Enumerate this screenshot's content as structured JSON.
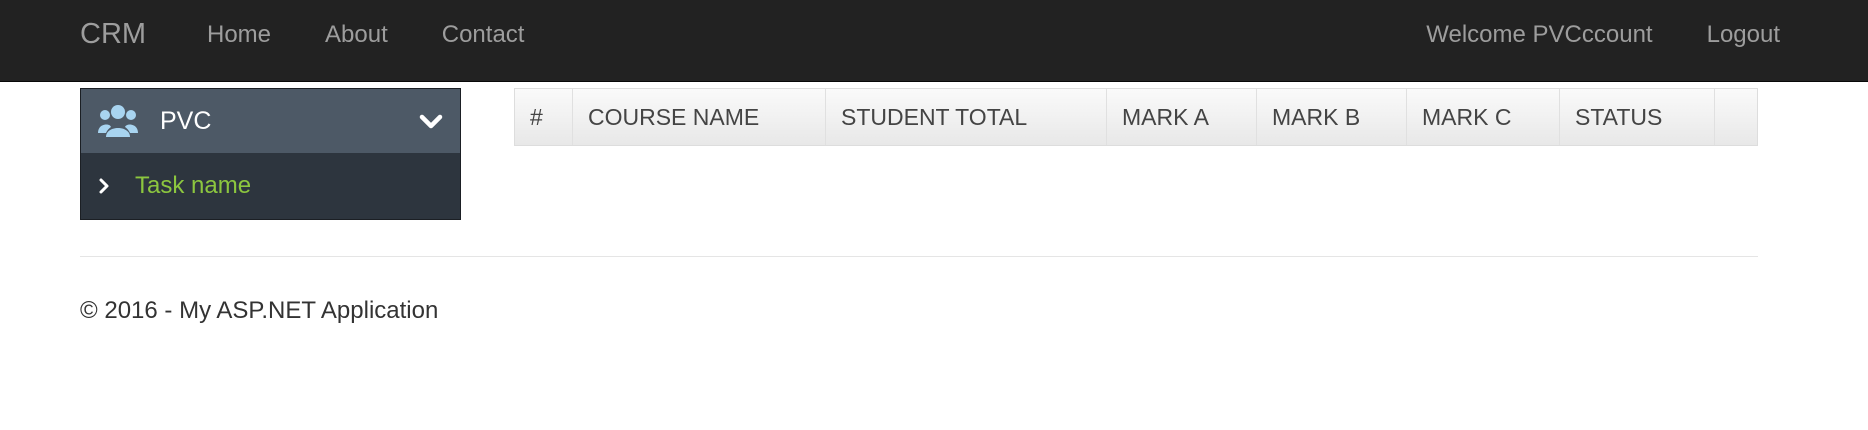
{
  "navbar": {
    "brand": "CRM",
    "links": [
      "Home",
      "About",
      "Contact"
    ],
    "welcome": "Welcome PVCccount",
    "logout": "Logout"
  },
  "sidebar": {
    "title": "PVC",
    "icon": "users-icon",
    "items": [
      {
        "label": "Task name",
        "icon": "chevron-right-icon"
      }
    ]
  },
  "grid": {
    "columns": [
      "#",
      "COURSE NAME",
      "STUDENT TOTAL",
      "MARK A",
      "MARK B",
      "MARK C",
      "STATUS",
      ""
    ],
    "rows": []
  },
  "footer": {
    "text": "© 2016 - My ASP.NET Application"
  },
  "colors": {
    "navbar_bg": "#222222",
    "nav_text": "#9d9d9d",
    "sidebar_bg": "#2d353e",
    "sidebar_header_bg": "#4d5966",
    "sidebar_item_text": "#8cc63f"
  }
}
